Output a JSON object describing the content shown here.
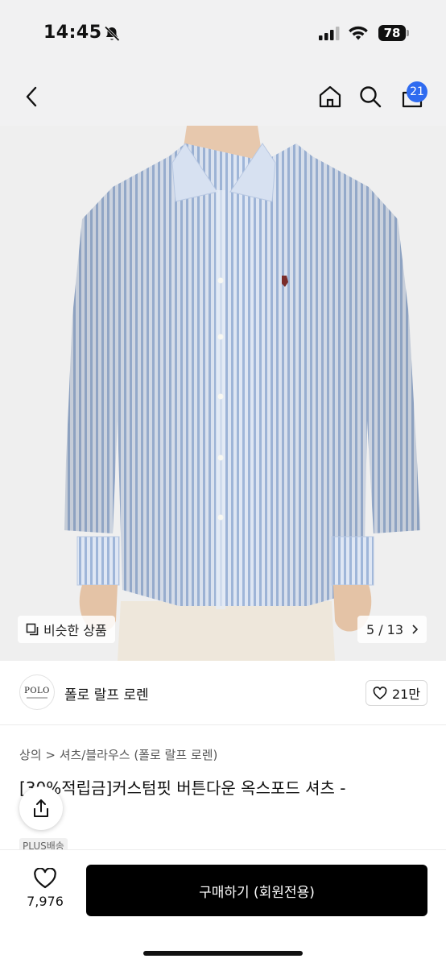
{
  "status_bar": {
    "time": "14:45",
    "battery": "78",
    "icons": [
      "bell-muted-icon",
      "cellular-signal-icon",
      "wifi-icon",
      "battery-icon"
    ]
  },
  "nav": {
    "icons": [
      "chevron-left-icon",
      "home-icon",
      "search-icon",
      "shopping-bag-icon"
    ],
    "cart_count": "21"
  },
  "gallery": {
    "similar_label": "비슷한 상품",
    "page_indicator": "5 / 13",
    "icons": [
      "similar-items-icon",
      "chevron-right-icon"
    ]
  },
  "brand": {
    "logo_text": "POLO",
    "name": "폴로 랄프 로렌",
    "likes": "21만"
  },
  "product": {
    "breadcrumb": "상의 > 셔츠/블라우스 (폴로 랄프 로렌)",
    "title": "[30%적립금]커스텀핏 버튼다운 옥스포드 셔츠 -",
    "tag": "PLUS배송"
  },
  "bottom": {
    "wish_count": "7,976",
    "buy_label": "구매하기 (회원전용)",
    "icons": [
      "heart-icon",
      "share-icon"
    ]
  },
  "colors": {
    "accent_badge": "#2f6bf0",
    "buy_button": "#000000",
    "background_top": "#f1f1f2"
  }
}
